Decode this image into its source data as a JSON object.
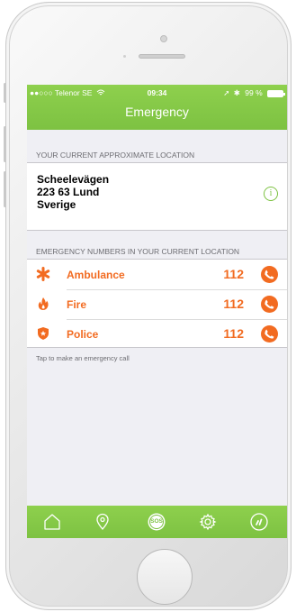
{
  "status_bar": {
    "carrier": "●●○○○ Telenor SE",
    "time": "09:34",
    "battery": "99 %"
  },
  "nav": {
    "title": "Emergency"
  },
  "location": {
    "section_header": "YOUR CURRENT APPROXIMATE LOCATION",
    "street": "Scheelevägen",
    "postal": "223 63 Lund",
    "country": "Sverige"
  },
  "numbers": {
    "section_header": "EMERGENCY NUMBERS IN YOUR CURRENT LOCATION",
    "items": [
      {
        "label": "Ambulance",
        "number": "112",
        "icon": "asterisk-icon"
      },
      {
        "label": "Fire",
        "number": "112",
        "icon": "flame-icon"
      },
      {
        "label": "Police",
        "number": "112",
        "icon": "police-badge-icon"
      }
    ],
    "hint": "Tap to make an emergency call"
  },
  "tabs": [
    {
      "name": "home-icon"
    },
    {
      "name": "location-pin-icon"
    },
    {
      "name": "sos-icon",
      "label": "SOS"
    },
    {
      "name": "gear-icon"
    },
    {
      "name": "speedometer-icon"
    }
  ],
  "colors": {
    "accent_green": "#7dc242",
    "accent_orange": "#f26b21",
    "background": "#efeff4"
  }
}
